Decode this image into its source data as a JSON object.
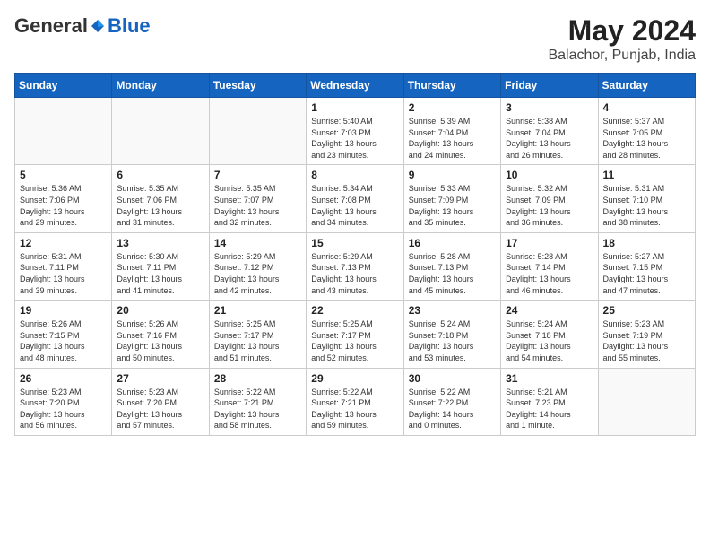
{
  "header": {
    "logo_general": "General",
    "logo_blue": "Blue",
    "month": "May 2024",
    "location": "Balachor, Punjab, India"
  },
  "weekdays": [
    "Sunday",
    "Monday",
    "Tuesday",
    "Wednesday",
    "Thursday",
    "Friday",
    "Saturday"
  ],
  "weeks": [
    [
      {
        "day": "",
        "info": ""
      },
      {
        "day": "",
        "info": ""
      },
      {
        "day": "",
        "info": ""
      },
      {
        "day": "1",
        "info": "Sunrise: 5:40 AM\nSunset: 7:03 PM\nDaylight: 13 hours\nand 23 minutes."
      },
      {
        "day": "2",
        "info": "Sunrise: 5:39 AM\nSunset: 7:04 PM\nDaylight: 13 hours\nand 24 minutes."
      },
      {
        "day": "3",
        "info": "Sunrise: 5:38 AM\nSunset: 7:04 PM\nDaylight: 13 hours\nand 26 minutes."
      },
      {
        "day": "4",
        "info": "Sunrise: 5:37 AM\nSunset: 7:05 PM\nDaylight: 13 hours\nand 28 minutes."
      }
    ],
    [
      {
        "day": "5",
        "info": "Sunrise: 5:36 AM\nSunset: 7:06 PM\nDaylight: 13 hours\nand 29 minutes."
      },
      {
        "day": "6",
        "info": "Sunrise: 5:35 AM\nSunset: 7:06 PM\nDaylight: 13 hours\nand 31 minutes."
      },
      {
        "day": "7",
        "info": "Sunrise: 5:35 AM\nSunset: 7:07 PM\nDaylight: 13 hours\nand 32 minutes."
      },
      {
        "day": "8",
        "info": "Sunrise: 5:34 AM\nSunset: 7:08 PM\nDaylight: 13 hours\nand 34 minutes."
      },
      {
        "day": "9",
        "info": "Sunrise: 5:33 AM\nSunset: 7:09 PM\nDaylight: 13 hours\nand 35 minutes."
      },
      {
        "day": "10",
        "info": "Sunrise: 5:32 AM\nSunset: 7:09 PM\nDaylight: 13 hours\nand 36 minutes."
      },
      {
        "day": "11",
        "info": "Sunrise: 5:31 AM\nSunset: 7:10 PM\nDaylight: 13 hours\nand 38 minutes."
      }
    ],
    [
      {
        "day": "12",
        "info": "Sunrise: 5:31 AM\nSunset: 7:11 PM\nDaylight: 13 hours\nand 39 minutes."
      },
      {
        "day": "13",
        "info": "Sunrise: 5:30 AM\nSunset: 7:11 PM\nDaylight: 13 hours\nand 41 minutes."
      },
      {
        "day": "14",
        "info": "Sunrise: 5:29 AM\nSunset: 7:12 PM\nDaylight: 13 hours\nand 42 minutes."
      },
      {
        "day": "15",
        "info": "Sunrise: 5:29 AM\nSunset: 7:13 PM\nDaylight: 13 hours\nand 43 minutes."
      },
      {
        "day": "16",
        "info": "Sunrise: 5:28 AM\nSunset: 7:13 PM\nDaylight: 13 hours\nand 45 minutes."
      },
      {
        "day": "17",
        "info": "Sunrise: 5:28 AM\nSunset: 7:14 PM\nDaylight: 13 hours\nand 46 minutes."
      },
      {
        "day": "18",
        "info": "Sunrise: 5:27 AM\nSunset: 7:15 PM\nDaylight: 13 hours\nand 47 minutes."
      }
    ],
    [
      {
        "day": "19",
        "info": "Sunrise: 5:26 AM\nSunset: 7:15 PM\nDaylight: 13 hours\nand 48 minutes."
      },
      {
        "day": "20",
        "info": "Sunrise: 5:26 AM\nSunset: 7:16 PM\nDaylight: 13 hours\nand 50 minutes."
      },
      {
        "day": "21",
        "info": "Sunrise: 5:25 AM\nSunset: 7:17 PM\nDaylight: 13 hours\nand 51 minutes."
      },
      {
        "day": "22",
        "info": "Sunrise: 5:25 AM\nSunset: 7:17 PM\nDaylight: 13 hours\nand 52 minutes."
      },
      {
        "day": "23",
        "info": "Sunrise: 5:24 AM\nSunset: 7:18 PM\nDaylight: 13 hours\nand 53 minutes."
      },
      {
        "day": "24",
        "info": "Sunrise: 5:24 AM\nSunset: 7:18 PM\nDaylight: 13 hours\nand 54 minutes."
      },
      {
        "day": "25",
        "info": "Sunrise: 5:23 AM\nSunset: 7:19 PM\nDaylight: 13 hours\nand 55 minutes."
      }
    ],
    [
      {
        "day": "26",
        "info": "Sunrise: 5:23 AM\nSunset: 7:20 PM\nDaylight: 13 hours\nand 56 minutes."
      },
      {
        "day": "27",
        "info": "Sunrise: 5:23 AM\nSunset: 7:20 PM\nDaylight: 13 hours\nand 57 minutes."
      },
      {
        "day": "28",
        "info": "Sunrise: 5:22 AM\nSunset: 7:21 PM\nDaylight: 13 hours\nand 58 minutes."
      },
      {
        "day": "29",
        "info": "Sunrise: 5:22 AM\nSunset: 7:21 PM\nDaylight: 13 hours\nand 59 minutes."
      },
      {
        "day": "30",
        "info": "Sunrise: 5:22 AM\nSunset: 7:22 PM\nDaylight: 14 hours\nand 0 minutes."
      },
      {
        "day": "31",
        "info": "Sunrise: 5:21 AM\nSunset: 7:23 PM\nDaylight: 14 hours\nand 1 minute."
      },
      {
        "day": "",
        "info": ""
      }
    ]
  ]
}
